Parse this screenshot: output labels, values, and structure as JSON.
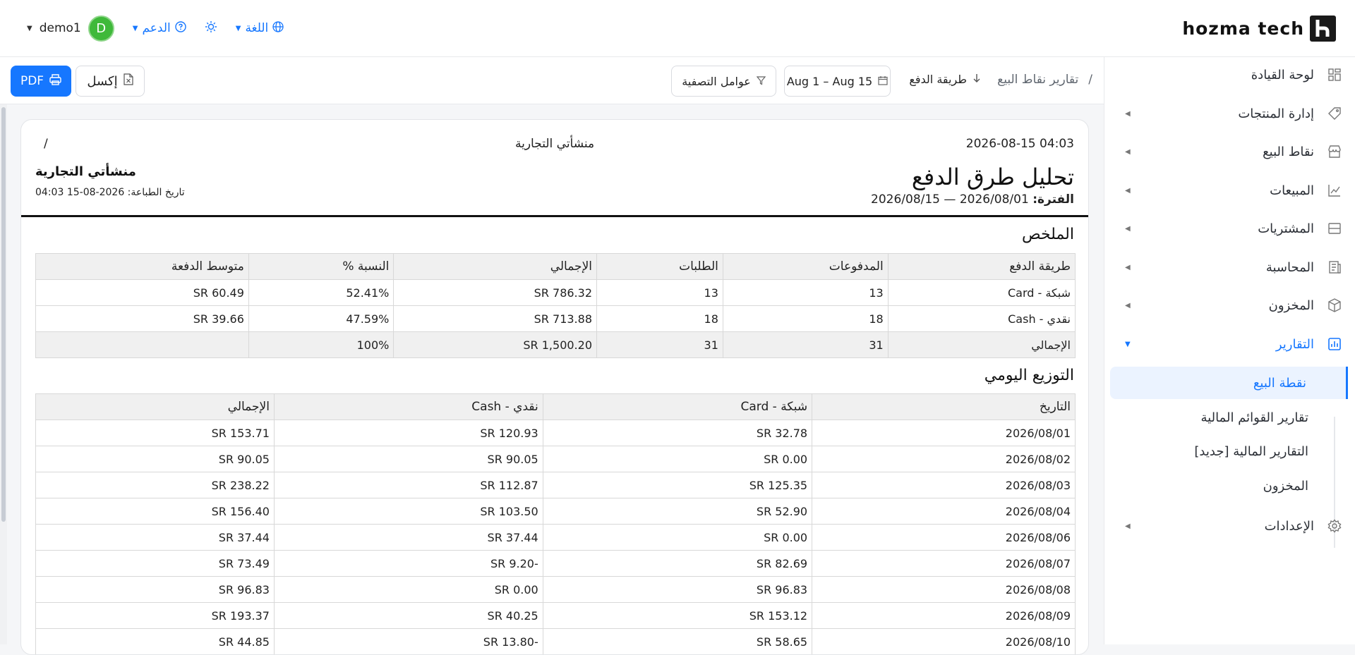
{
  "header": {
    "logo_text": "hozma tech",
    "language_label": "اللغة",
    "support_label": "الدعم",
    "username": "demo1",
    "avatar_letter": "D"
  },
  "sidebar": {
    "items": [
      {
        "label": "لوحة القيادة",
        "icon": "dashboard-icon"
      },
      {
        "label": "إدارة المنتجات",
        "icon": "tag-icon"
      },
      {
        "label": "نقاط البيع",
        "icon": "store-icon"
      },
      {
        "label": "المبيعات",
        "icon": "chart-line-icon"
      },
      {
        "label": "المشتريات",
        "icon": "inbox-icon"
      },
      {
        "label": "المحاسبة",
        "icon": "ledger-icon"
      },
      {
        "label": "المخزون",
        "icon": "box-icon"
      },
      {
        "label": "التقارير",
        "icon": "report-icon"
      },
      {
        "label": "الإعدادات",
        "icon": "gear-icon"
      }
    ],
    "sub_items": [
      {
        "label": "نقطة البيع"
      },
      {
        "label": "تقارير القوائم المالية"
      },
      {
        "label": "التقارير المالية [جديد]"
      },
      {
        "label": "المخزون"
      }
    ]
  },
  "toolbar": {
    "breadcrumb_root": "تقارير نقاط البيع",
    "breadcrumb_sep": "/",
    "sort_label": "طريقة الدفع",
    "date_range": "Aug 1 – Aug 15",
    "filter_label": "عوامل التصفية",
    "excel_label": "إكسل",
    "pdf_label": "PDF"
  },
  "report": {
    "print_datetime": "2026-08-15 04:03",
    "center_title": "منشأتي التجارية",
    "slash": "/",
    "title": "تحليل طرق الدفع",
    "period_label": "الفترة:",
    "period_value": "2026/08/01 — 2026/08/15",
    "business_name": "منشأتي التجارية",
    "print_date_line": "تاريخ الطباعة: 2026-08-15 04:03",
    "summary_title": "الملخص",
    "summary_headers": [
      "طريقة الدفع",
      "المدفوعات",
      "الطلبات",
      "الإجمالي",
      "النسبة %",
      "متوسط الدفعة"
    ],
    "summary_rows": [
      [
        "شبكة - Card",
        "13",
        "13",
        "SR 786.32",
        "52.41%",
        "SR 60.49"
      ],
      [
        "نقدي - Cash",
        "18",
        "18",
        "SR 713.88",
        "47.59%",
        "SR 39.66"
      ]
    ],
    "summary_total": [
      "الإجمالي",
      "31",
      "31",
      "SR 1,500.20",
      "100%",
      ""
    ],
    "daily_title": "التوزيع اليومي",
    "daily_headers": [
      "التاريخ",
      "شبكة - Card",
      "نقدي - Cash",
      "الإجمالي"
    ],
    "daily_rows": [
      [
        "2026/08/01",
        "SR 32.78",
        "SR 120.93",
        "SR 153.71"
      ],
      [
        "2026/08/02",
        "SR 0.00",
        "SR 90.05",
        "SR 90.05"
      ],
      [
        "2026/08/03",
        "SR 125.35",
        "SR 112.87",
        "SR 238.22"
      ],
      [
        "2026/08/04",
        "SR 52.90",
        "SR 103.50",
        "SR 156.40"
      ],
      [
        "2026/08/06",
        "SR 0.00",
        "SR 37.44",
        "SR 37.44"
      ],
      [
        "2026/08/07",
        "SR 82.69",
        "SR 9.20-",
        "SR 73.49"
      ],
      [
        "2026/08/08",
        "SR 96.83",
        "SR 0.00",
        "SR 96.83"
      ],
      [
        "2026/08/09",
        "SR 153.12",
        "SR 40.25",
        "SR 193.37"
      ],
      [
        "2026/08/10",
        "SR 58.65",
        "SR 13.80-",
        "SR 44.85"
      ]
    ]
  }
}
